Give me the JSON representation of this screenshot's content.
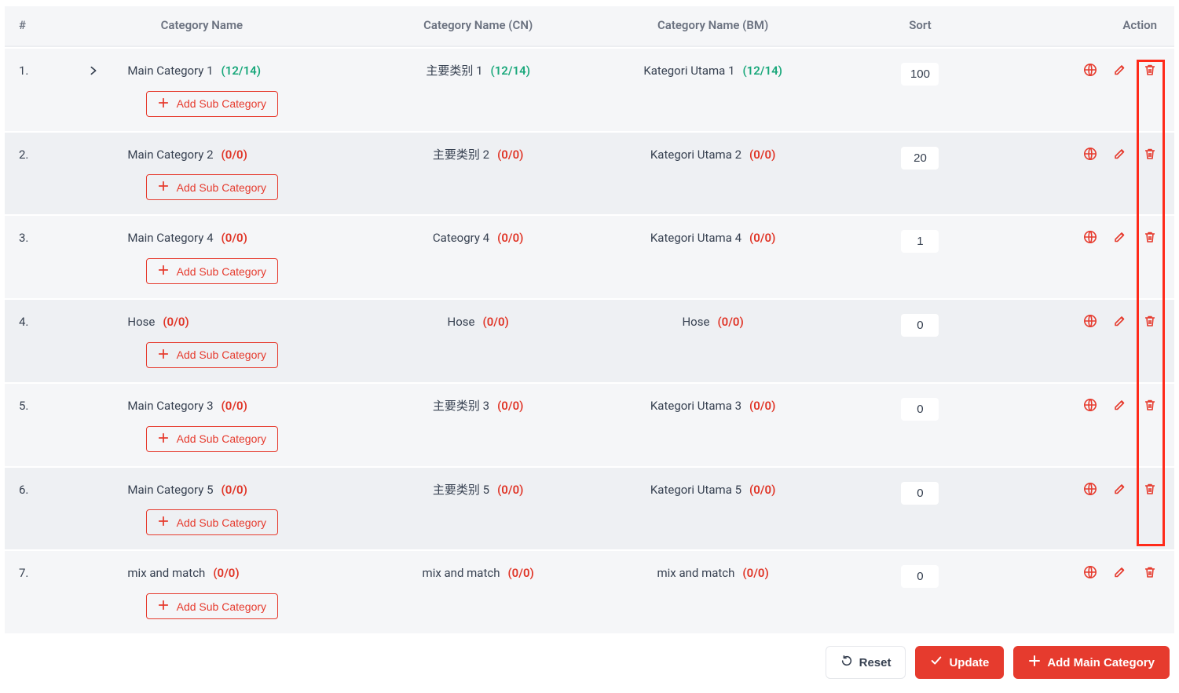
{
  "headers": {
    "idx": "#",
    "name": "Category Name",
    "cn": "Category Name (CN)",
    "bm": "Category Name (BM)",
    "sort": "Sort",
    "action": "Action"
  },
  "labels": {
    "add_sub": "Add Sub Category",
    "reset": "Reset",
    "update": "Update",
    "add_main": "Add Main Category"
  },
  "rows": [
    {
      "idx": "1.",
      "expandable": true,
      "name": "Main Category 1",
      "name_count": "(12/14)",
      "name_count_color": "green",
      "cn": "主要类别 1",
      "cn_count": "(12/14)",
      "cn_count_color": "green",
      "bm": "Kategori Utama 1",
      "bm_count": "(12/14)",
      "bm_count_color": "green",
      "sort": "100"
    },
    {
      "idx": "2.",
      "expandable": false,
      "name": "Main Category 2",
      "name_count": "(0/0)",
      "name_count_color": "red",
      "cn": "主要类别 2",
      "cn_count": "(0/0)",
      "cn_count_color": "red",
      "bm": "Kategori Utama 2",
      "bm_count": "(0/0)",
      "bm_count_color": "red",
      "sort": "20"
    },
    {
      "idx": "3.",
      "expandable": false,
      "name": "Main Category 4",
      "name_count": "(0/0)",
      "name_count_color": "red",
      "cn": "Cateogry 4",
      "cn_count": "(0/0)",
      "cn_count_color": "red",
      "bm": "Kategori Utama 4",
      "bm_count": "(0/0)",
      "bm_count_color": "red",
      "sort": "1"
    },
    {
      "idx": "4.",
      "expandable": false,
      "name": "Hose",
      "name_count": "(0/0)",
      "name_count_color": "red",
      "cn": "Hose",
      "cn_count": "(0/0)",
      "cn_count_color": "red",
      "bm": "Hose",
      "bm_count": "(0/0)",
      "bm_count_color": "red",
      "sort": "0"
    },
    {
      "idx": "5.",
      "expandable": false,
      "name": "Main Category 3",
      "name_count": "(0/0)",
      "name_count_color": "red",
      "cn": "主要类别 3",
      "cn_count": "(0/0)",
      "cn_count_color": "red",
      "bm": "Kategori Utama 3",
      "bm_count": "(0/0)",
      "bm_count_color": "red",
      "sort": "0"
    },
    {
      "idx": "6.",
      "expandable": false,
      "name": "Main Category 5",
      "name_count": "(0/0)",
      "name_count_color": "red",
      "cn": "主要类别 5",
      "cn_count": "(0/0)",
      "cn_count_color": "red",
      "bm": "Kategori Utama 5",
      "bm_count": "(0/0)",
      "bm_count_color": "red",
      "sort": "0"
    },
    {
      "idx": "7.",
      "expandable": false,
      "name": "mix and match",
      "name_count": "(0/0)",
      "name_count_color": "red",
      "cn": "mix and match",
      "cn_count": "(0/0)",
      "cn_count_color": "red",
      "bm": "mix and match",
      "bm_count": "(0/0)",
      "bm_count_color": "red",
      "sort": "0"
    }
  ]
}
